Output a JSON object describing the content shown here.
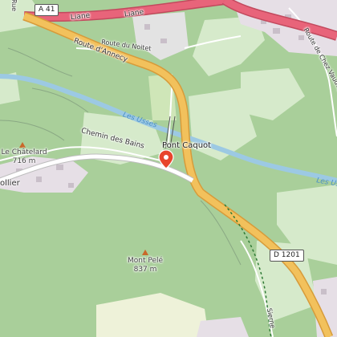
{
  "map": {
    "colors": {
      "forest": "#a9cf9a",
      "meadow": "#d6eacb",
      "urban": "#e6dfe6",
      "water": "#9cc9e3",
      "major_road": "#f2c15c",
      "major_road_casing": "#d79b3a",
      "motorway": "#e8647a",
      "marker": "#e8452c"
    },
    "roads": {
      "motorway_shield": "A 41",
      "liane_top": "Liane",
      "liane_center": "Liane",
      "route_annecy": "Route d'Annecy",
      "route_noitet": "Route du Noitet",
      "route_chez_vaudey": "Route de Chez Vaudey",
      "chemin_bains": "Chemin des Bains",
      "d1201_shield": "D 1201",
      "rue_partial": "Rue",
      "sierne_partial": "Sierne"
    },
    "water": {
      "river_label": "Les Usses",
      "river_partial": "Les Usses"
    },
    "places": {
      "bridge": "Pont Caquot",
      "le_chatelard": {
        "name": "Le Châtelard",
        "elevation": "716 m"
      },
      "mont_pele": {
        "name": "Mont Pelé",
        "elevation": "837 m"
      },
      "village_partial": "ollier"
    },
    "icons": {
      "marker": "map-pin-icon",
      "summit": "summit-triangle-icon"
    }
  }
}
